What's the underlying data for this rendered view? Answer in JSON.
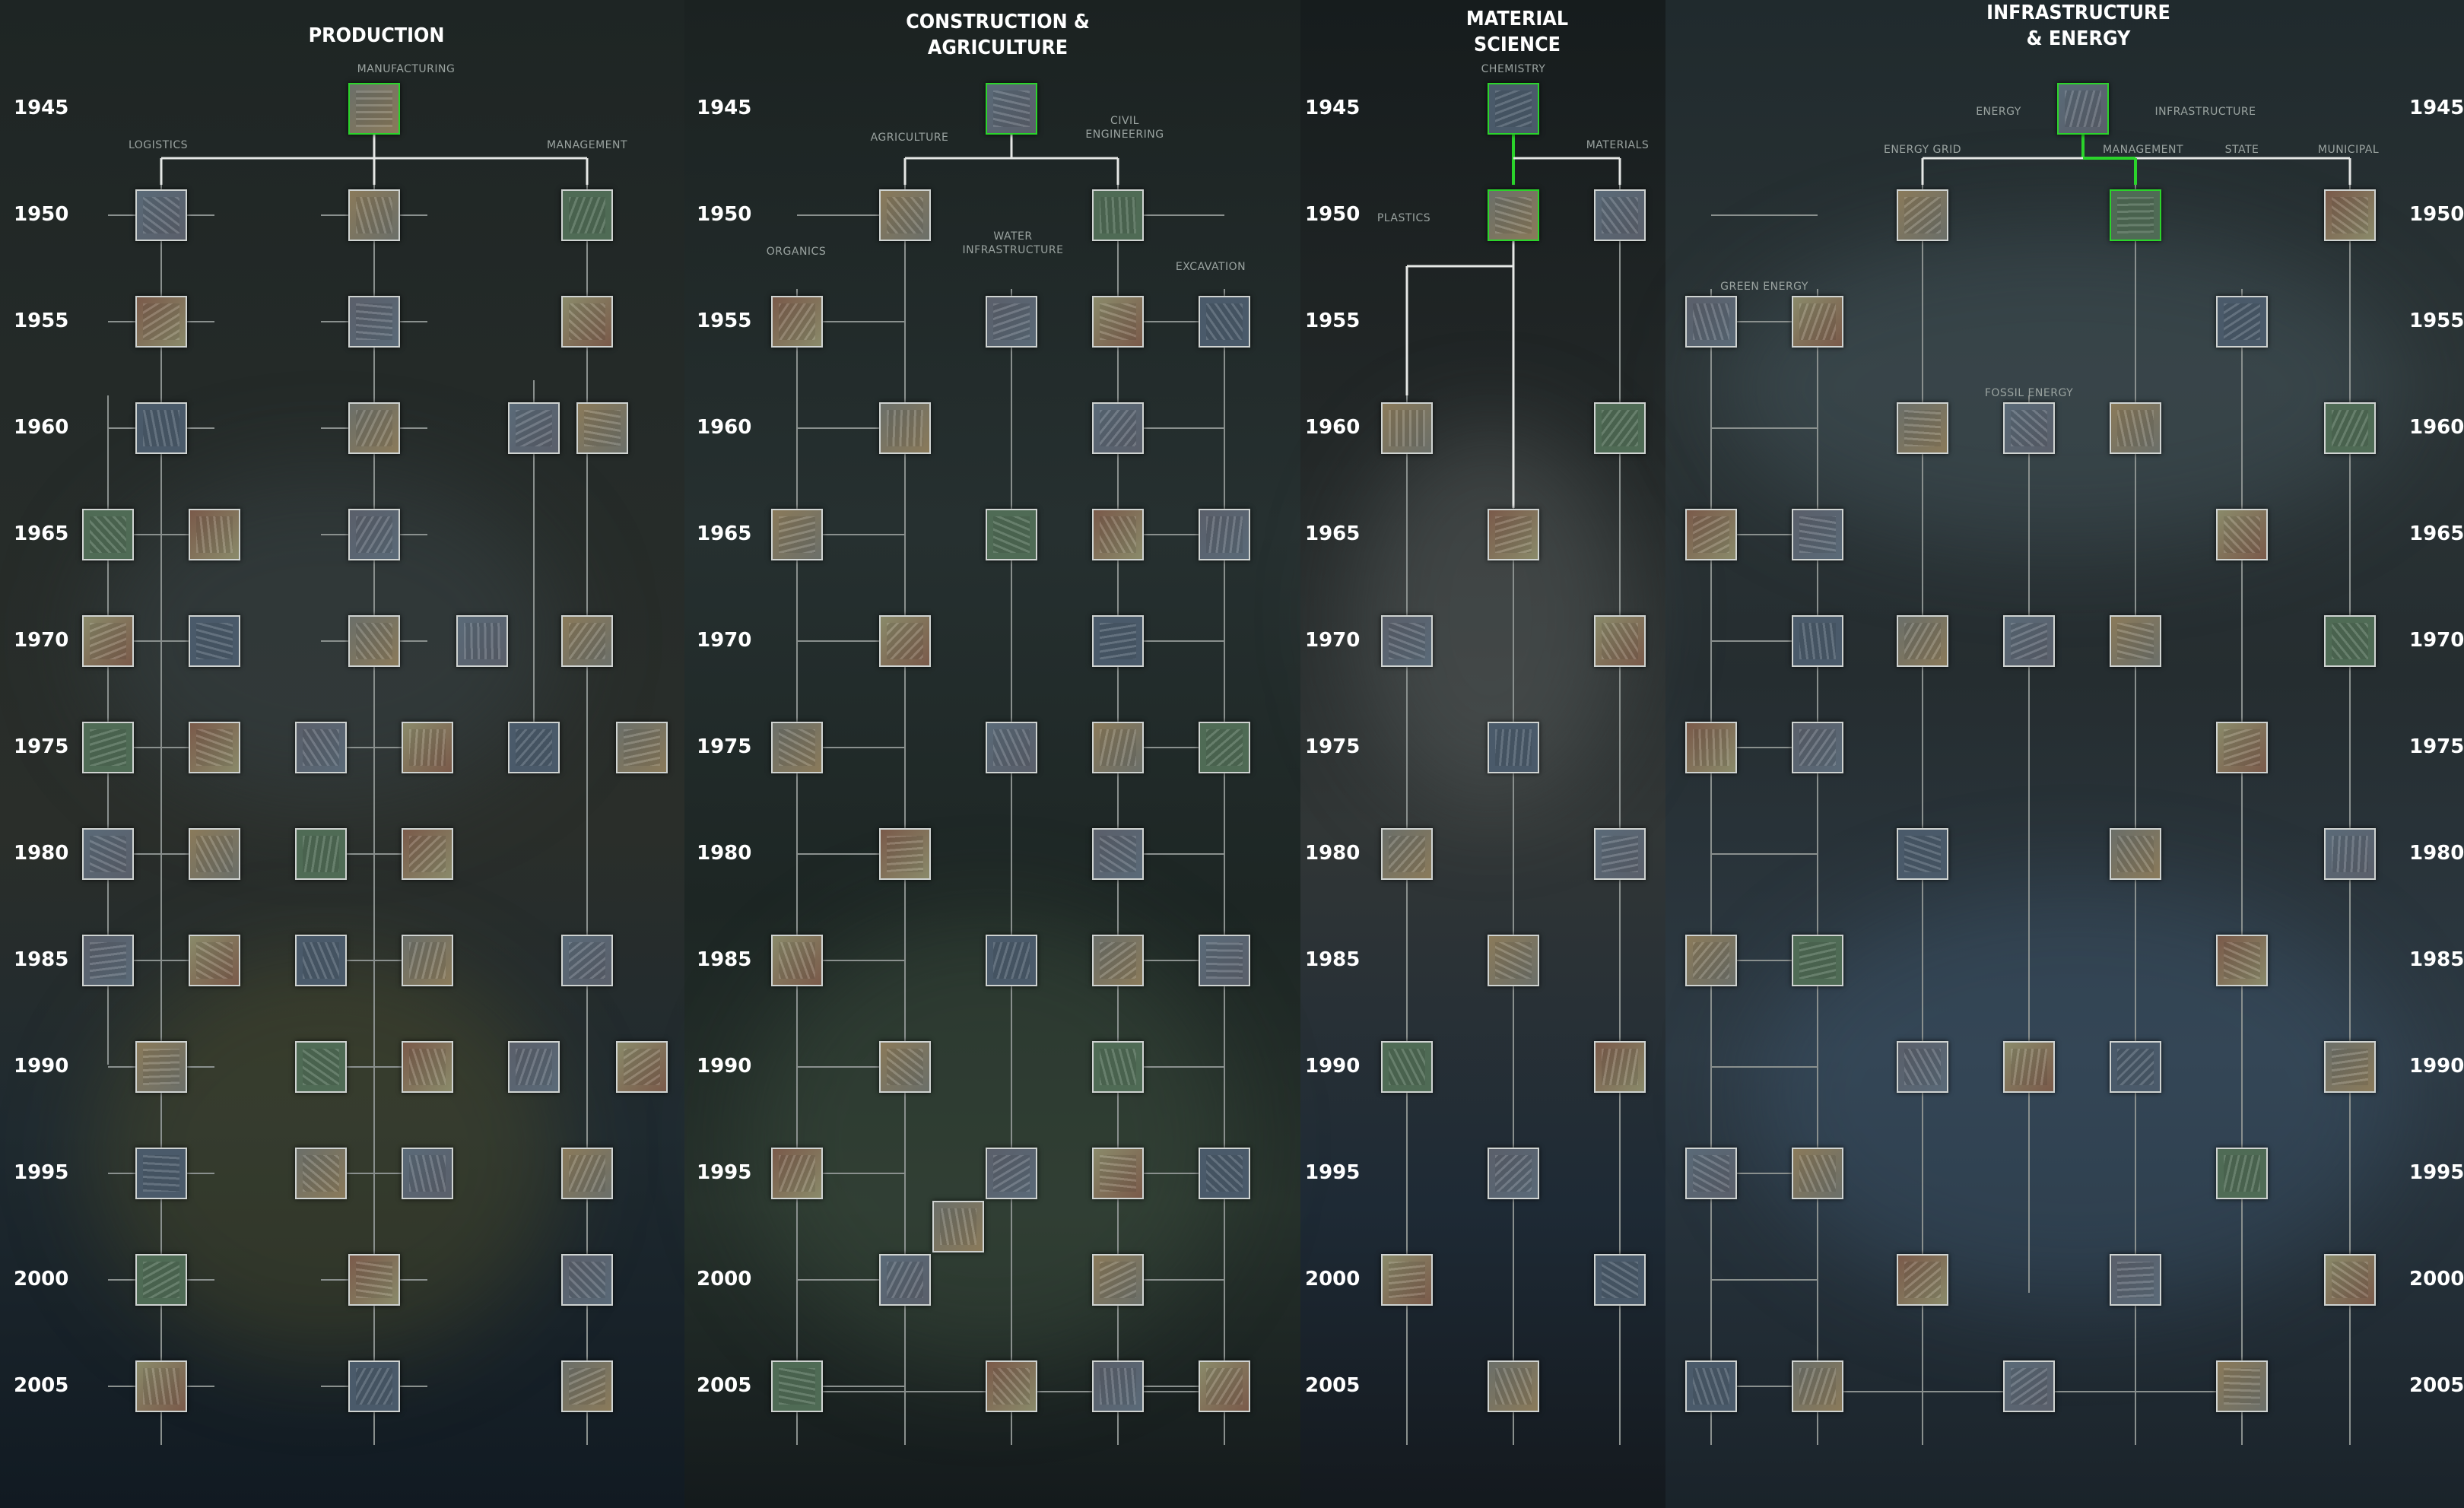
{
  "sections": [
    {
      "title": "PRODUCTION"
    },
    {
      "title": "CONSTRUCTION &\nAGRICULTURE"
    },
    {
      "title": "MATERIAL\nSCIENCE"
    },
    {
      "title": "INFRASTRUCTURE\n& ENERGY"
    }
  ],
  "years": [
    "1945",
    "1950",
    "1955",
    "1960",
    "1965",
    "1970",
    "1975",
    "1980",
    "1985",
    "1990",
    "1995",
    "2000",
    "2005"
  ],
  "labels": {
    "manufacturing": "MANUFACTURING",
    "logistics": "LOGISTICS",
    "management_prod": "MANAGEMENT",
    "agriculture": "AGRICULTURE",
    "civil_engineering": "CIVIL\nENGINEERING",
    "organics": "ORGANICS",
    "water_infrastructure": "WATER\nINFRASTRUCTURE",
    "excavation": "EXCAVATION",
    "chemistry": "CHEMISTRY",
    "materials": "MATERIALS",
    "plastics": "PLASTICS",
    "energy": "ENERGY",
    "infrastructure": "INFRASTRUCTURE",
    "energy_grid": "ENERGY GRID",
    "management_infra": "MANAGEMENT",
    "state": "STATE",
    "municipal": "MUNICIPAL",
    "green_energy": "GREEN ENERGY",
    "fossil_energy": "FOSSIL ENERGY"
  },
  "colors": {
    "background": "#141a1b",
    "node_border": "#cfd3d1",
    "highlight": "#2bd42b",
    "line": "#8a908e",
    "bright_line": "#e6e8e6",
    "text": "#ffffff",
    "label": "#9aa3a0"
  },
  "nodes": [
    {
      "c": 0,
      "y": 0,
      "a": "gear-machinery-icon",
      "h": 1
    },
    {
      "c": 0,
      "y": 1,
      "a": "aircraft-icon"
    },
    {
      "c": 0,
      "y": 1,
      "a": "welding-icon"
    },
    {
      "c": 0,
      "y": 1,
      "a": "handshake-icon"
    },
    {
      "c": 0,
      "y": 2,
      "a": "pallet-icon"
    },
    {
      "c": 0,
      "y": 2,
      "a": "factory-line-icon"
    },
    {
      "c": 0,
      "y": 2,
      "a": "hardhat-icon"
    },
    {
      "c": 0,
      "y": 3,
      "a": "flowchart-icon"
    },
    {
      "c": 0,
      "y": 3,
      "a": "cnc-icon"
    },
    {
      "c": 0,
      "y": 3,
      "a": "worker-icon"
    },
    {
      "c": 0,
      "y": 3,
      "a": "chart-icon"
    },
    {
      "c": 0,
      "y": 4,
      "a": "warehouse-icon"
    },
    {
      "c": 0,
      "y": 4,
      "a": "shelves-icon"
    },
    {
      "c": 0,
      "y": 4,
      "a": "assembly-icon"
    },
    {
      "c": 0,
      "y": 5,
      "a": "truck-icon"
    },
    {
      "c": 0,
      "y": 5,
      "a": "container-icon"
    },
    {
      "c": 0,
      "y": 5,
      "a": "robot-arm-icon"
    },
    {
      "c": 0,
      "y": 5,
      "a": "forklift-icon"
    },
    {
      "c": 0,
      "y": 5,
      "a": "office-icon"
    },
    {
      "c": 0,
      "y": 6,
      "a": "barcode-icon"
    },
    {
      "c": 0,
      "y": 6,
      "a": "boxes-icon"
    },
    {
      "c": 0,
      "y": 6,
      "a": "inspection-icon"
    },
    {
      "c": 0,
      "y": 6,
      "a": "robot-icon"
    },
    {
      "c": 0,
      "y": 6,
      "a": "conveyor-icon"
    },
    {
      "c": 0,
      "y": 6,
      "a": "storage-icon"
    },
    {
      "c": 0,
      "y": 7,
      "a": "computer-icon"
    },
    {
      "c": 0,
      "y": 7,
      "a": "terminal-icon"
    },
    {
      "c": 0,
      "y": 7,
      "a": "robot-cell-icon"
    },
    {
      "c": 0,
      "y": 7,
      "a": "industrial-robot-icon"
    },
    {
      "c": 0,
      "y": 8,
      "a": "jet-icon"
    },
    {
      "c": 0,
      "y": 8,
      "a": "plane-icon"
    },
    {
      "c": 0,
      "y": 8,
      "a": "laser-icon"
    },
    {
      "c": 0,
      "y": 8,
      "a": "cnc-head-icon"
    },
    {
      "c": 0,
      "y": 8,
      "a": "presentation-icon"
    },
    {
      "c": 0,
      "y": 9,
      "a": "crane-icon"
    },
    {
      "c": 0,
      "y": 9,
      "a": "machining-icon"
    },
    {
      "c": 0,
      "y": 9,
      "a": "welding-robot-icon"
    },
    {
      "c": 0,
      "y": 9,
      "a": "shelf-storage-icon"
    },
    {
      "c": 0,
      "y": 9,
      "a": "retail-shelf-icon"
    },
    {
      "c": 0,
      "y": 10,
      "a": "technician-icon"
    },
    {
      "c": 0,
      "y": 10,
      "a": "press-icon"
    },
    {
      "c": 0,
      "y": 10,
      "a": "automated-warehouse-icon"
    },
    {
      "c": 0,
      "y": 10,
      "a": "steps-diagram-icon"
    },
    {
      "c": 0,
      "y": 11,
      "a": "drone-icon"
    },
    {
      "c": 0,
      "y": 11,
      "a": "robotic-welder-icon"
    },
    {
      "c": 0,
      "y": 11,
      "a": "dashboard-icon"
    },
    {
      "c": 0,
      "y": 12,
      "a": "tunnel-icon"
    },
    {
      "c": 0,
      "y": 12,
      "a": "surgical-robot-icon"
    },
    {
      "c": 0,
      "y": 12,
      "a": "tablet-icon"
    },
    {
      "c": 1,
      "y": 0,
      "a": "scaffolding-icon",
      "h": 1
    },
    {
      "c": 1,
      "y": 1,
      "a": "molecule-diagram-icon"
    },
    {
      "c": 1,
      "y": 1,
      "a": "columns-icon"
    },
    {
      "c": 1,
      "y": 2,
      "a": "seedling-icon"
    },
    {
      "c": 1,
      "y": 2,
      "a": "pipes-icon"
    },
    {
      "c": 1,
      "y": 2,
      "a": "drill-icon"
    },
    {
      "c": 1,
      "y": 2,
      "a": "rebar-icon"
    },
    {
      "c": 1,
      "y": 3,
      "a": "field-icon"
    },
    {
      "c": 1,
      "y": 3,
      "a": "excavator-icon"
    },
    {
      "c": 1,
      "y": 4,
      "a": "leaf-icon"
    },
    {
      "c": 1,
      "y": 4,
      "a": "solar-field-icon"
    },
    {
      "c": 1,
      "y": 4,
      "a": "bridge-icon"
    },
    {
      "c": 1,
      "y": 4,
      "a": "bulldozer-icon"
    },
    {
      "c": 1,
      "y": 5,
      "a": "crop-rows-icon"
    },
    {
      "c": 1,
      "y": 5,
      "a": "dam-icon"
    },
    {
      "c": 1,
      "y": 6,
      "a": "farmland-icon"
    },
    {
      "c": 1,
      "y": 6,
      "a": "treatment-plant-icon"
    },
    {
      "c": 1,
      "y": 6,
      "a": "skyscraper-icon"
    },
    {
      "c": 1,
      "y": 6,
      "a": "demolition-icon"
    },
    {
      "c": 1,
      "y": 7,
      "a": "tractor-icon"
    },
    {
      "c": 1,
      "y": 7,
      "a": "cad-icon"
    },
    {
      "c": 1,
      "y": 8,
      "a": "mining-icon"
    },
    {
      "c": 1,
      "y": 8,
      "a": "pump-station-icon"
    },
    {
      "c": 1,
      "y": 8,
      "a": "steel-frame-icon"
    },
    {
      "c": 1,
      "y": 8,
      "a": "boring-machine-icon"
    },
    {
      "c": 1,
      "y": 9,
      "a": "terrain-model-icon"
    },
    {
      "c": 1,
      "y": 9,
      "a": "road-icon"
    },
    {
      "c": 1,
      "y": 10,
      "a": "farmer-icon"
    },
    {
      "c": 1,
      "y": 10,
      "a": "water-tank-icon"
    },
    {
      "c": 1,
      "y": 10,
      "a": "geodesic-icon"
    },
    {
      "c": 1,
      "y": 10,
      "a": "tower-crane-icon"
    },
    {
      "c": 1,
      "y": 11,
      "a": "greenhouse-icon"
    },
    {
      "c": 1,
      "y": 12,
      "a": "combine-icon"
    },
    {
      "c": 1,
      "y": 12,
      "a": "laptop-icon"
    },
    {
      "c": 1,
      "y": 13,
      "a": "wheat-icon"
    },
    {
      "c": 1,
      "y": 13,
      "a": "canal-icon"
    },
    {
      "c": 1,
      "y": 13,
      "a": "port-icon"
    },
    {
      "c": 1,
      "y": 13,
      "a": "oil-rig-icon"
    },
    {
      "c": 2,
      "y": 0,
      "a": "periodic-table-icon",
      "h": 1
    },
    {
      "c": 2,
      "y": 1,
      "a": "prism-icon",
      "h": 1
    },
    {
      "c": 2,
      "y": 1,
      "a": "pipe-icon"
    },
    {
      "c": 2,
      "y": 3,
      "a": "color-fan-icon"
    },
    {
      "c": 2,
      "y": 3,
      "a": "glass-panel-icon"
    },
    {
      "c": 2,
      "y": 4,
      "a": "spectrum-icon"
    },
    {
      "c": 2,
      "y": 5,
      "a": "vest-icon"
    },
    {
      "c": 2,
      "y": 5,
      "a": "metal-part-icon"
    },
    {
      "c": 2,
      "y": 6,
      "a": "chemistry-book-icon"
    },
    {
      "c": 2,
      "y": 7,
      "a": "bearing-icon"
    },
    {
      "c": 2,
      "y": 7,
      "a": "cylinders-icon"
    },
    {
      "c": 2,
      "y": 8,
      "a": "nanostructure-icon"
    },
    {
      "c": 2,
      "y": 9,
      "a": "circuit-chip-icon"
    },
    {
      "c": 2,
      "y": 9,
      "a": "fullerene-icon"
    },
    {
      "c": 2,
      "y": 10,
      "a": "nanotube-icon"
    },
    {
      "c": 2,
      "y": 11,
      "a": "lab-flasks-icon"
    },
    {
      "c": 2,
      "y": 11,
      "a": "mesh-icon"
    },
    {
      "c": 2,
      "y": 12,
      "a": "glass-facade-icon"
    },
    {
      "c": 3,
      "y": 0,
      "a": "locomotive-icon",
      "h": 1
    },
    {
      "c": 3,
      "y": 1,
      "a": "power-pole-icon"
    },
    {
      "c": 3,
      "y": 1,
      "a": "aerial-city-icon",
      "h": 1
    },
    {
      "c": 3,
      "y": 1,
      "a": "railway-icon"
    },
    {
      "c": 3,
      "y": 2,
      "a": "meter-icon"
    },
    {
      "c": 3,
      "y": 2,
      "a": "wind-turbine-icon"
    },
    {
      "c": 3,
      "y": 2,
      "a": "train-icon"
    },
    {
      "c": 3,
      "y": 3,
      "a": "pylon-icon"
    },
    {
      "c": 3,
      "y": 3,
      "a": "refinery-icon"
    },
    {
      "c": 3,
      "y": 3,
      "a": "mast-icon"
    },
    {
      "c": 3,
      "y": 3,
      "a": "rail-yard-icon"
    },
    {
      "c": 3,
      "y": 4,
      "a": "reactor-icon"
    },
    {
      "c": 3,
      "y": 4,
      "a": "cooling-tower-icon"
    },
    {
      "c": 3,
      "y": 4,
      "a": "traffic-icon"
    },
    {
      "c": 3,
      "y": 5,
      "a": "chimney-icon"
    },
    {
      "c": 3,
      "y": 5,
      "a": "transmission-icon"
    },
    {
      "c": 3,
      "y": 5,
      "a": "pipeline-icon"
    },
    {
      "c": 3,
      "y": 5,
      "a": "plant-icon"
    },
    {
      "c": 3,
      "y": 5,
      "a": "subway-icon"
    },
    {
      "c": 3,
      "y": 6,
      "a": "generator-icon"
    },
    {
      "c": 3,
      "y": 6,
      "a": "solar-panel-icon"
    },
    {
      "c": 3,
      "y": 6,
      "a": "bus-icon"
    },
    {
      "c": 3,
      "y": 7,
      "a": "tower-icon"
    },
    {
      "c": 3,
      "y": 7,
      "a": "worker-site-icon"
    },
    {
      "c": 3,
      "y": 7,
      "a": "ticket-gate-icon"
    },
    {
      "c": 3,
      "y": 8,
      "a": "insulator-icon"
    },
    {
      "c": 3,
      "y": 8,
      "a": "wind-farm-icon"
    },
    {
      "c": 3,
      "y": 8,
      "a": "highspeed-train-icon"
    },
    {
      "c": 3,
      "y": 9,
      "a": "substation-icon"
    },
    {
      "c": 3,
      "y": 9,
      "a": "offshore-icon"
    },
    {
      "c": 3,
      "y": 9,
      "a": "roadworks-icon"
    },
    {
      "c": 3,
      "y": 9,
      "a": "monorail-icon"
    },
    {
      "c": 3,
      "y": 10,
      "a": "sensor-icon"
    },
    {
      "c": 3,
      "y": 10,
      "a": "hydro-icon"
    },
    {
      "c": 3,
      "y": 10,
      "a": "tram-icon"
    },
    {
      "c": 3,
      "y": 11,
      "a": "grid-tower-icon"
    },
    {
      "c": 3,
      "y": 11,
      "a": "crane-line-icon"
    },
    {
      "c": 3,
      "y": 11,
      "a": "highway-icon"
    },
    {
      "c": 3,
      "y": 12,
      "a": "battery-icon"
    },
    {
      "c": 3,
      "y": 12,
      "a": "turbine-icon"
    },
    {
      "c": 3,
      "y": 12,
      "a": "ev-icon"
    },
    {
      "c": 3,
      "y": 12,
      "a": "metro-icon"
    }
  ]
}
